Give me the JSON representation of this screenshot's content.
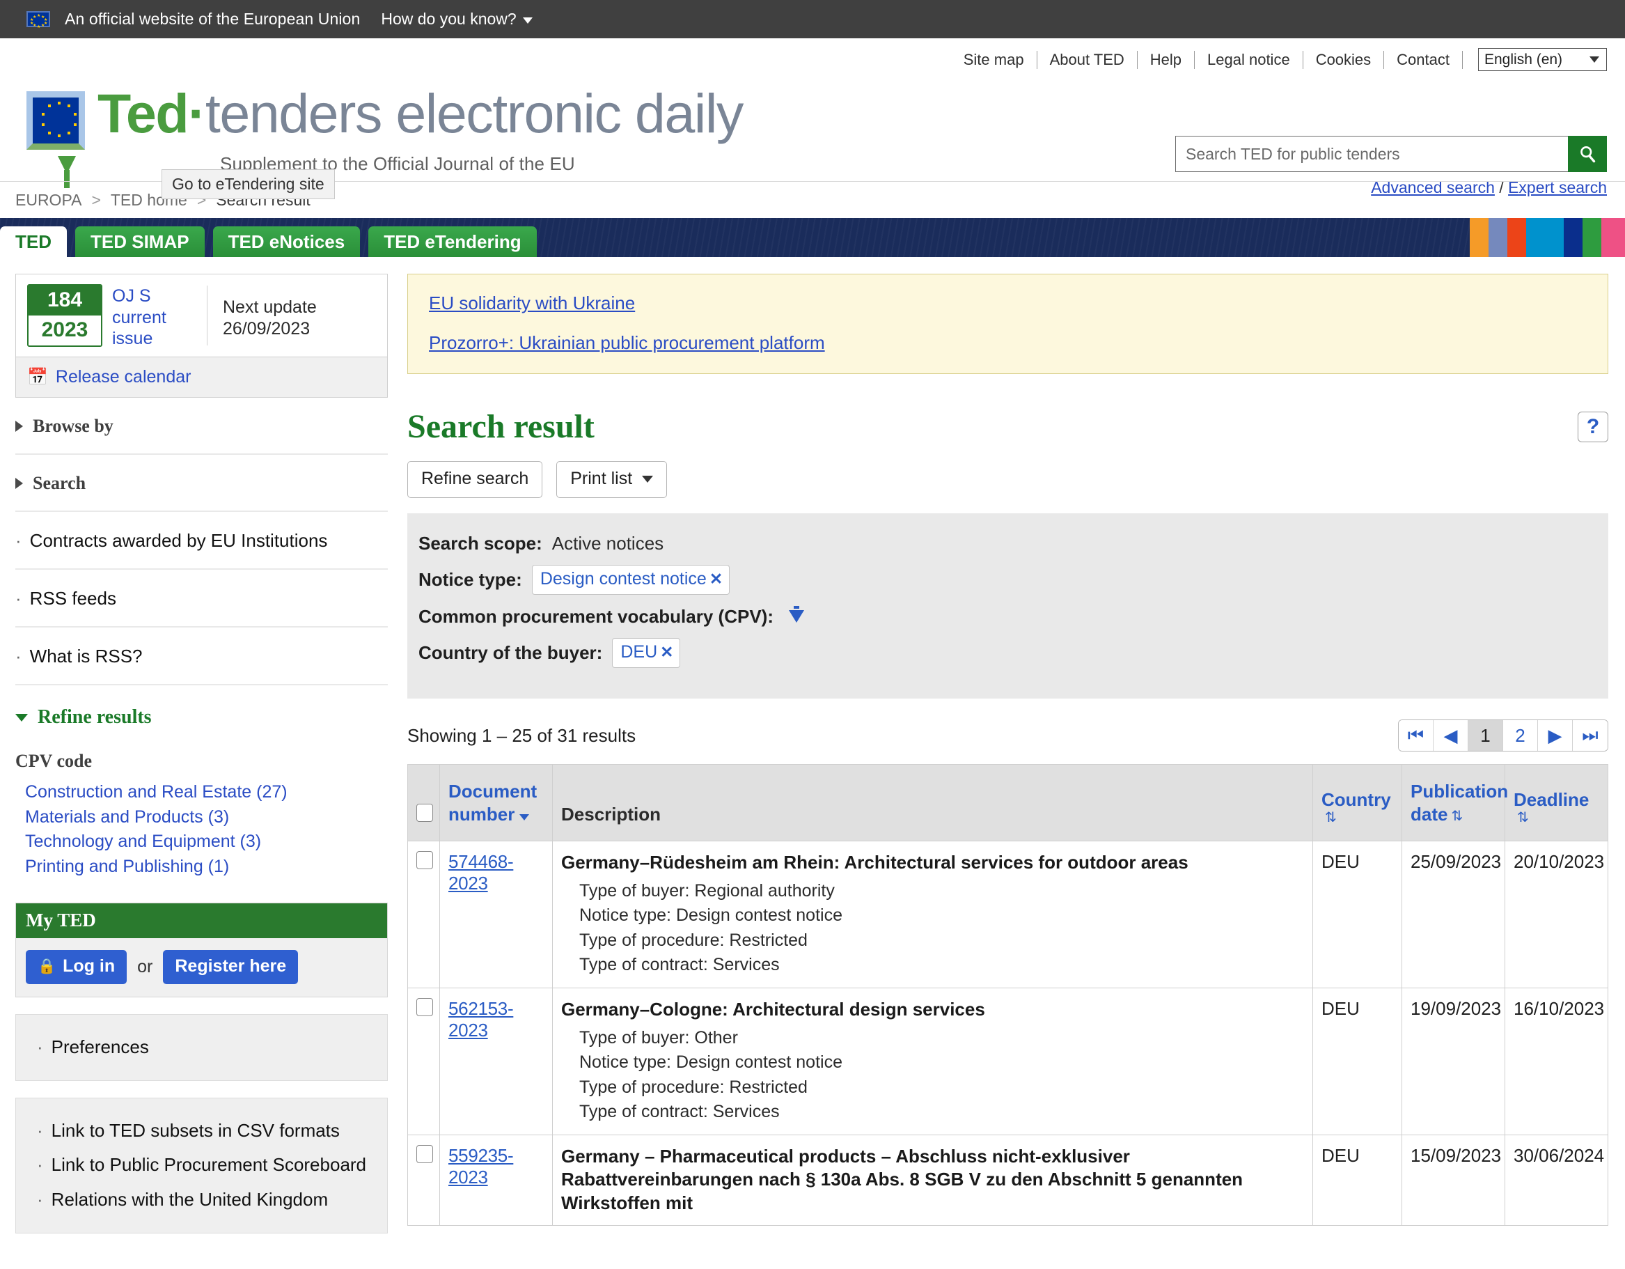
{
  "eu_banner": {
    "text": "An official website of the European Union",
    "how_do_you_know": "How do you know?"
  },
  "util_nav": {
    "links": [
      "Site map",
      "About TED",
      "Help",
      "Legal notice",
      "Cookies",
      "Contact"
    ],
    "language": "English (en)"
  },
  "logo": {
    "ted": "Ted",
    "dot": "·",
    "rest": "tenders electronic daily",
    "subtitle": "Supplement to the Official Journal of the EU"
  },
  "search": {
    "placeholder": "Search TED for public tenders",
    "advanced": "Advanced search",
    "separator": "/",
    "expert": "Expert search"
  },
  "breadcrumb": {
    "items": [
      "EUROPA",
      "TED home",
      "Search result"
    ],
    "tooltip": "Go to eTendering site"
  },
  "tabs": [
    {
      "label": "TED",
      "active": true
    },
    {
      "label": "TED SIMAP",
      "active": false
    },
    {
      "label": "TED eNotices",
      "active": false
    },
    {
      "label": "TED eTendering",
      "active": false
    }
  ],
  "stripe_colors": [
    "#f59b28",
    "#7589bd",
    "#ec4418",
    "#0092cd",
    "#0a2e8c",
    "#2e9c3f",
    "#ee5185"
  ],
  "sidebar": {
    "oj": {
      "issue_number": "184",
      "issue_year": "2023",
      "issue_label": "OJ S current issue",
      "next_update_label": "Next update",
      "next_update_date": "26/09/2023",
      "release_calendar": "Release calendar"
    },
    "browse_by": "Browse by",
    "search": "Search",
    "links": [
      "Contracts awarded by EU Institutions",
      "RSS feeds",
      "What is RSS?"
    ],
    "refine_results": "Refine results",
    "cpv_heading": "CPV code",
    "cpv_items": [
      "Construction and Real Estate (27)",
      "Materials and Products (3)",
      "Technology and Equipment (3)",
      "Printing and Publishing (1)"
    ],
    "my_ted": {
      "title": "My TED",
      "login": "Log in",
      "or": "or",
      "register": "Register here"
    },
    "preferences": "Preferences",
    "bottom_links": [
      "Link to TED subsets in CSV formats",
      "Link to Public Procurement Scoreboard",
      "Relations with the United Kingdom"
    ]
  },
  "notices": {
    "ukraine": "EU solidarity with Ukraine",
    "prozorro": "Prozorro+: Ukrainian public procurement platform"
  },
  "main": {
    "title": "Search result",
    "help": "?",
    "refine_search": "Refine search",
    "print_list": "Print list",
    "scope": {
      "search_scope_label": "Search scope:",
      "search_scope_value": "Active notices",
      "notice_type_label": "Notice type:",
      "notice_type_chip": "Design contest notice",
      "cpv_label": "Common procurement vocabulary (CPV):",
      "country_label": "Country of the buyer:",
      "country_chip": "DEU"
    },
    "showing": "Showing 1 – 25 of 31 results",
    "pager": {
      "first": "|◀",
      "prev": "◀",
      "pages": [
        "1",
        "2"
      ],
      "current": "1",
      "next": "▶",
      "last": "▶|"
    },
    "table": {
      "headers": {
        "document_number": "Document number",
        "description": "Description",
        "country": "Country",
        "publication_date": "Publication date",
        "deadline": "Deadline"
      },
      "rows": [
        {
          "doc": "574468-2023",
          "title": "Germany–Rüdesheim am Rhein: Architectural services for outdoor areas",
          "meta": [
            "Type of buyer: Regional authority",
            "Notice type: Design contest notice",
            "Type of procedure: Restricted",
            "Type of contract: Services"
          ],
          "country": "DEU",
          "publication_date": "25/09/2023",
          "deadline": "20/10/2023"
        },
        {
          "doc": "562153-2023",
          "title": "Germany–Cologne: Architectural design services",
          "meta": [
            "Type of buyer: Other",
            "Notice type: Design contest notice",
            "Type of procedure: Restricted",
            "Type of contract: Services"
          ],
          "country": "DEU",
          "publication_date": "19/09/2023",
          "deadline": "16/10/2023"
        },
        {
          "doc": "559235-2023",
          "title": "Germany – Pharmaceutical products – Abschluss nicht-exklusiver Rabattvereinbarungen nach § 130a Abs. 8 SGB V zu den Abschnitt 5 genannten Wirkstoffen mit",
          "meta": [],
          "country": "DEU",
          "publication_date": "15/09/2023",
          "deadline": "30/06/2024"
        }
      ]
    }
  }
}
